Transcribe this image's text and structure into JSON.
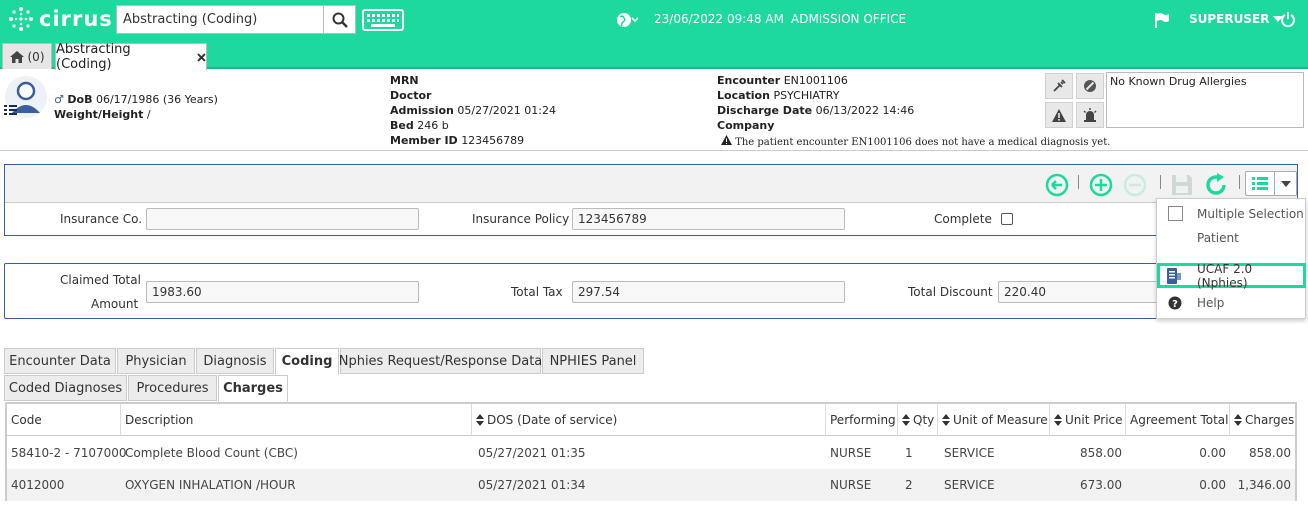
{
  "app": {
    "name": "cirrus"
  },
  "search": {
    "value": "Abstracting (Coding)"
  },
  "header": {
    "datetime": "23/06/2022 09:48 AM",
    "office": "ADMISSION OFFICE",
    "user": "SUPERUSER"
  },
  "tabs_top": {
    "home_count": "(0)",
    "active_tab": "Abstracting (Coding)"
  },
  "patient": {
    "dob_label": "DoB",
    "dob_value": "06/17/1986 (36 Years)",
    "weight_label": "Weight/Height",
    "weight_value": "/",
    "mrn_label": "MRN",
    "doctor_label": "Doctor",
    "admission_label": "Admission",
    "admission_value": "05/27/2021 01:24",
    "bed_label": "Bed",
    "bed_value": "246 b",
    "member_label": "Member ID",
    "member_value": "123456789",
    "encounter_label": "Encounter",
    "encounter_value": "EN1001106",
    "location_label": "Location",
    "location_value": "PSYCHIATRY",
    "discharge_label": "Discharge Date",
    "discharge_value": "06/13/2022 14:46",
    "company_label": "Company",
    "warning": "The patient encounter EN1001106 does not have a medical diagnosis yet.",
    "allergies": "No Known Drug Allergies"
  },
  "form": {
    "insurance_co_label": "Insurance Co.",
    "insurance_co_value": "",
    "insurance_policy_label": "Insurance Policy",
    "insurance_policy_value": "123456789",
    "complete_label": "Complete",
    "claimed_total_label_1": "Claimed Total",
    "claimed_total_label_2": "Amount",
    "claimed_total_value": "1983.60",
    "total_tax_label": "Total Tax",
    "total_tax_value": "297.54",
    "total_discount_label": "Total Discount",
    "total_discount_value": "220.40"
  },
  "dropdown": {
    "items": [
      "Multiple Selection",
      "Patient",
      "UCAF 2.0 (Nphies)",
      "Help"
    ]
  },
  "tabs": [
    "Encounter Data",
    "Physician",
    "Diagnosis",
    "Coding",
    "Nphies Request/Response Data",
    "NPHIES Panel"
  ],
  "subtabs": [
    "Coded Diagnoses",
    "Procedures",
    "Charges"
  ],
  "table": {
    "headers": [
      "Code",
      "Description",
      "DOS (Date of service)",
      "Performing",
      "Qty",
      "Unit of Measure",
      "Unit Price",
      "Agreement Total",
      "Charges"
    ],
    "rows": [
      [
        "58410-2 - 7107000",
        "Complete Blood Count (CBC)",
        "05/27/2021 01:35",
        "NURSE",
        "1",
        "SERVICE",
        "858.00",
        "0.00",
        "858.00"
      ],
      [
        "4012000",
        "OXYGEN INHALATION /HOUR",
        "05/27/2021 01:34",
        "NURSE",
        "2",
        "SERVICE",
        "673.00",
        "0.00",
        "1,346.00"
      ]
    ]
  },
  "colors": {
    "brand": "#1dd9a0",
    "panel_border": "#3a5f9f"
  }
}
